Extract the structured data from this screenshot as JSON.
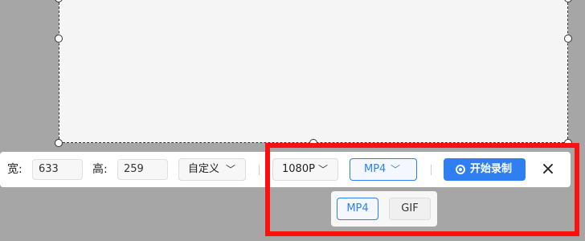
{
  "toolbar": {
    "width_label": "宽:",
    "width_value": "633",
    "height_label": "高:",
    "height_value": "259",
    "preset": "自定义",
    "resolution": "1080P",
    "format": "MP4",
    "record_label": "开始录制"
  },
  "format_menu": {
    "options": [
      "MP4",
      "GIF"
    ],
    "selected": "MP4"
  },
  "icons": {
    "dropdown": "chevron-down-icon",
    "record": "record-dot-icon",
    "close": "close-icon"
  },
  "colors": {
    "accent": "#2f7ff1",
    "highlight": "#ff1010",
    "backdrop": "#a6a6a6"
  }
}
